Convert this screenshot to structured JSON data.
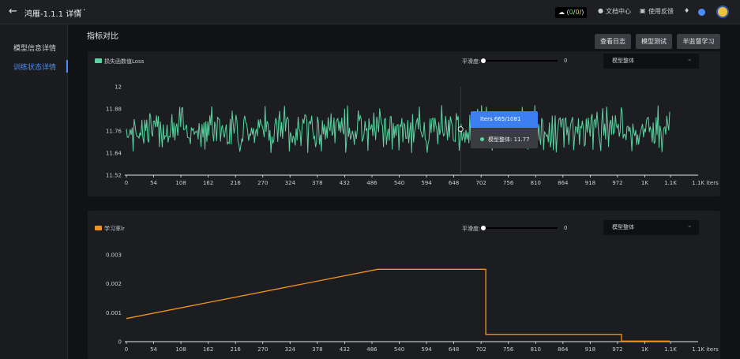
{
  "header": {
    "title": "鸿雁-1.1.1 详情",
    "more": "···",
    "quota": {
      "open": "(",
      "val1": "0",
      "sep": "/",
      "val2": "0",
      "close": "/)"
    },
    "links": [
      "文档中心",
      "使用反馈"
    ]
  },
  "sidebar": {
    "items": [
      "模型信息详情",
      "训练状态详情"
    ],
    "active_index": 1
  },
  "main": {
    "section_title": "指标对比",
    "buttons": [
      "查看日志",
      "模型测试",
      "半监督学习"
    ]
  },
  "charts": [
    {
      "legend": "损失函数值Loss",
      "legend_color": "#5ad3a0",
      "smooth_label": "平滑度:",
      "smooth_value": "0",
      "smooth_fraction": 0,
      "select_value": "模型整体",
      "tooltip": {
        "title": "Iters 665/1081",
        "series": "模型整体",
        "value": "11.77"
      }
    },
    {
      "legend": "学习率lr",
      "legend_color": "#f2931f",
      "smooth_label": "平滑度:",
      "smooth_value": "0",
      "smooth_fraction": 0,
      "select_value": "模型整体"
    }
  ],
  "chart_data": [
    {
      "type": "line",
      "series": [
        {
          "name": "损失函数值Loss",
          "color": "#5ad3a0",
          "x_range": [
            0,
            1081
          ],
          "y_min": 11.64,
          "y_max": 11.9,
          "y_typical": 11.77
        }
      ],
      "x_ticks": [
        "0",
        "54",
        "108",
        "162",
        "216",
        "270",
        "324",
        "378",
        "432",
        "486",
        "540",
        "594",
        "648",
        "702",
        "756",
        "810",
        "864",
        "918",
        "972",
        "1K",
        "1.1K",
        "1.1K iters"
      ],
      "y_ticks": [
        "11.52",
        "11.64",
        "11.76",
        "11.88",
        "12"
      ],
      "ylim": [
        11.52,
        12
      ],
      "xlabel": "iters",
      "hover": {
        "x": 665,
        "y": 11.77
      }
    },
    {
      "type": "line",
      "series": [
        {
          "name": "学习率lr",
          "color": "#f2931f",
          "x": [
            0,
            500,
            715,
            715,
            985,
            985,
            1081
          ],
          "y": [
            0.0008,
            0.0025,
            0.0025,
            0.00025,
            0.00025,
            2e-05,
            2e-05
          ]
        }
      ],
      "x_ticks": [
        "0",
        "54",
        "108",
        "162",
        "216",
        "270",
        "324",
        "378",
        "432",
        "486",
        "540",
        "594",
        "648",
        "702",
        "756",
        "810",
        "864",
        "918",
        "972",
        "1K",
        "1.1K",
        "1.1K iters"
      ],
      "y_ticks": [
        "0",
        "0.001",
        "0.002",
        "0.003"
      ],
      "ylim": [
        0,
        0.003
      ],
      "xlabel": "iters"
    }
  ]
}
